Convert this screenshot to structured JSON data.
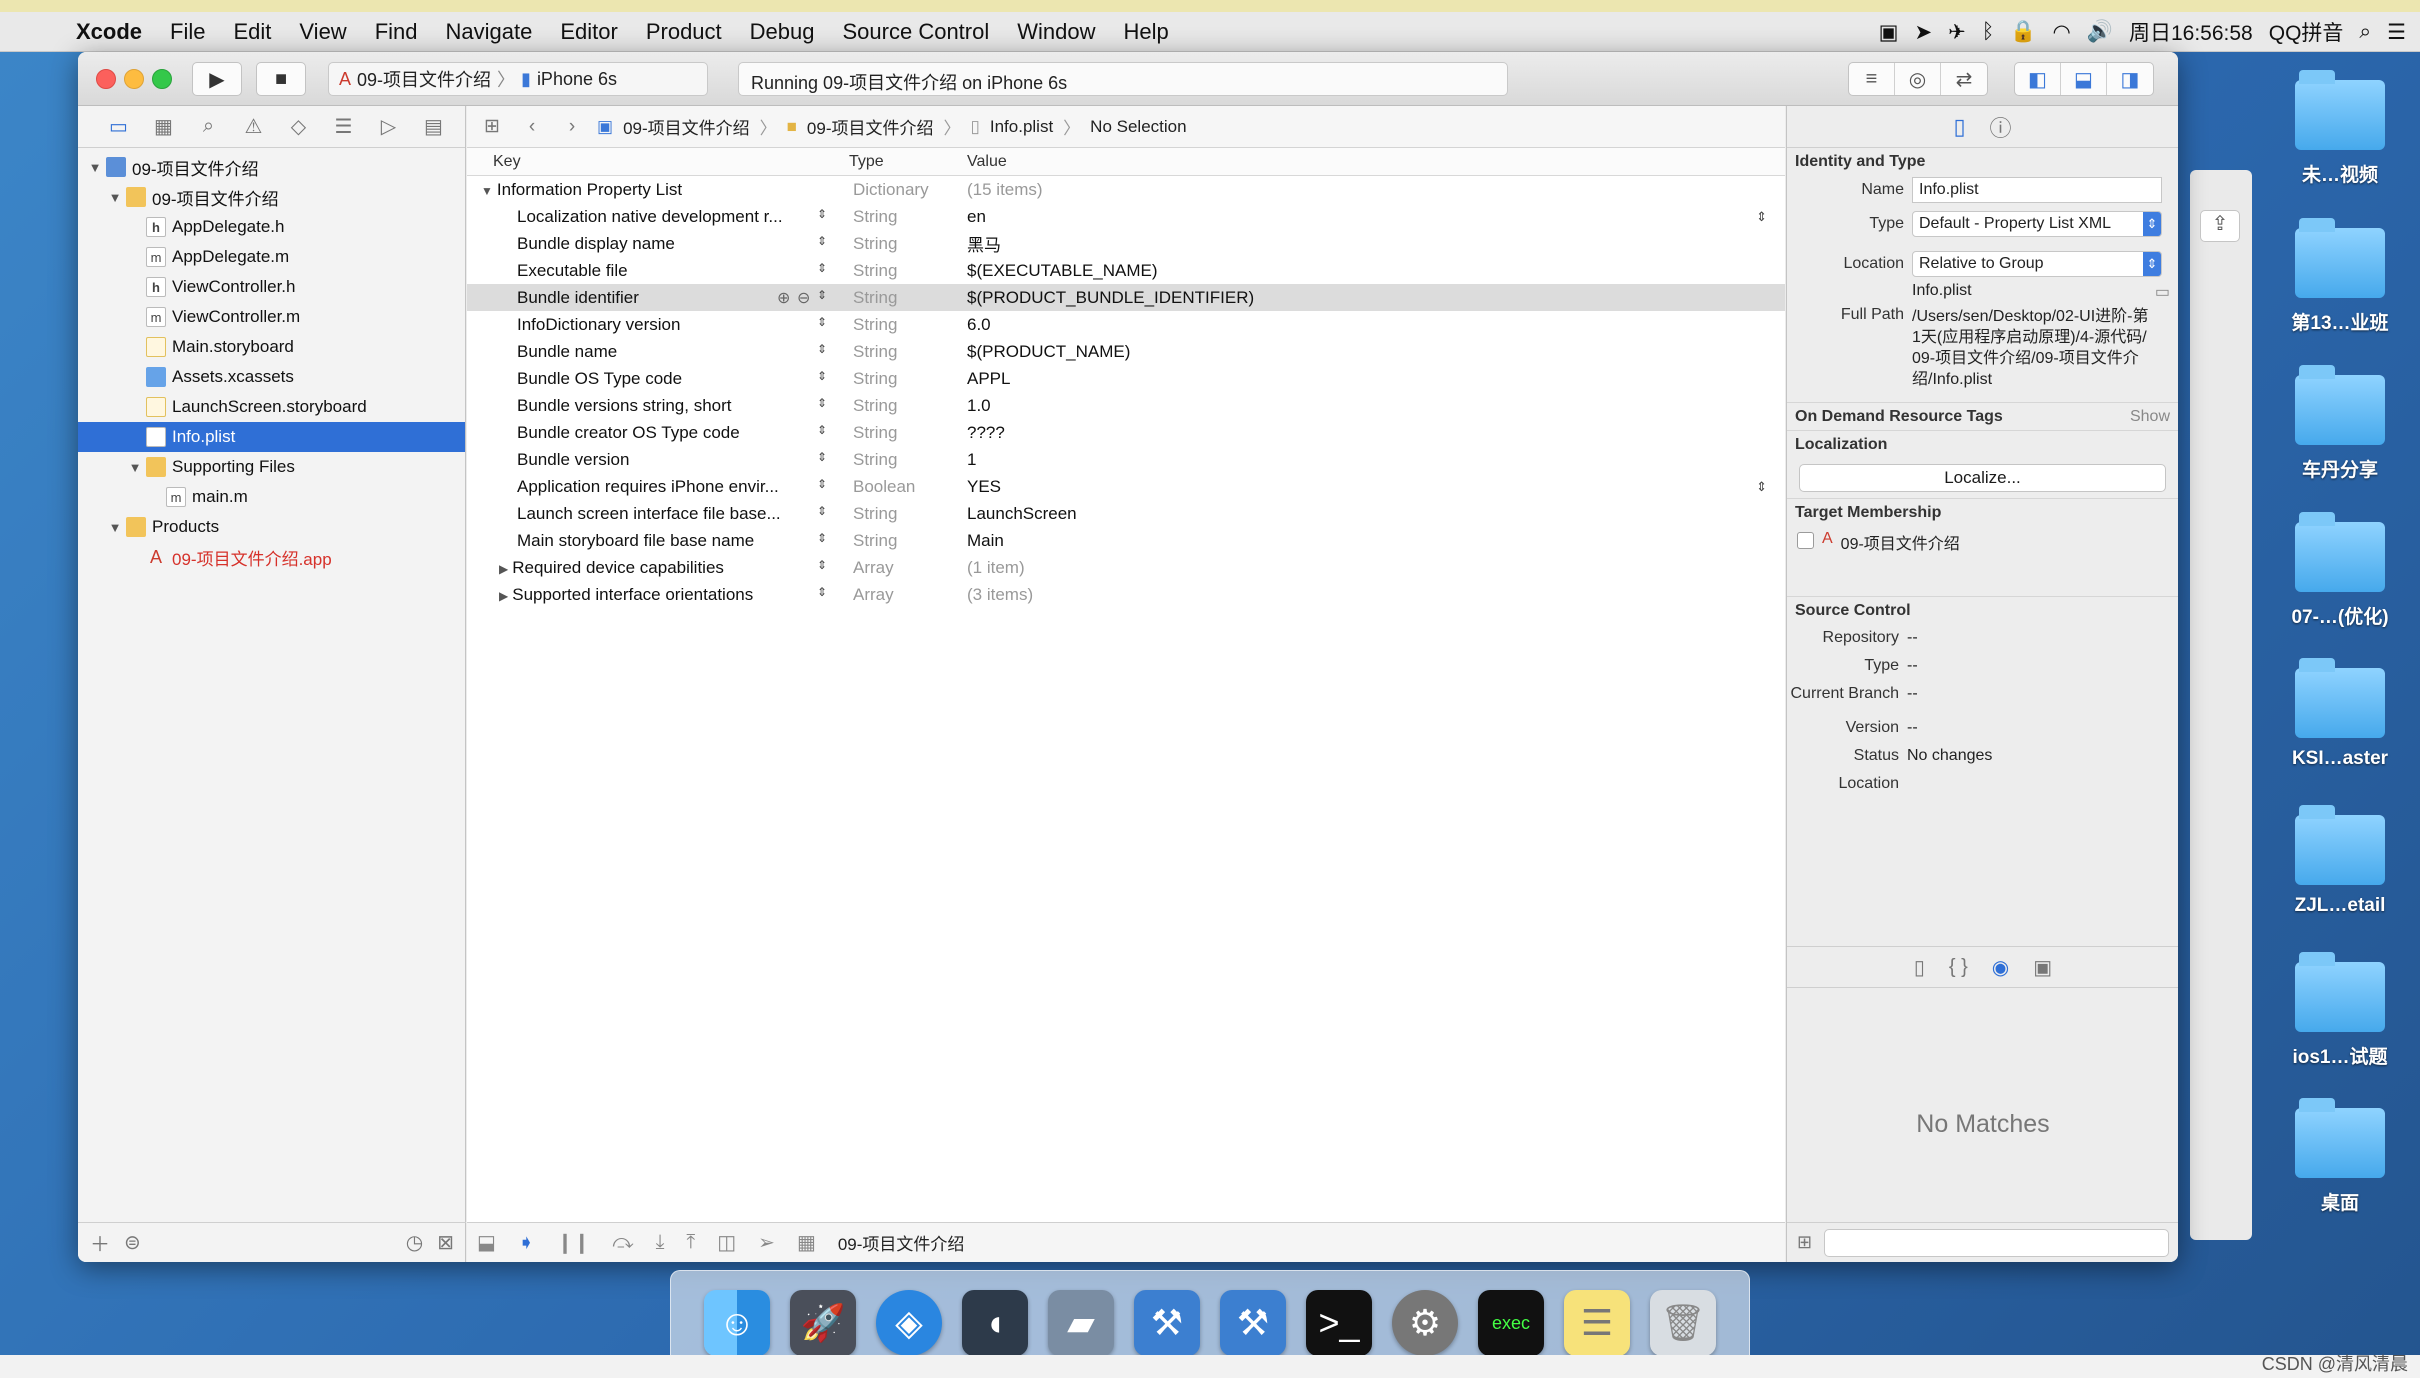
{
  "menubar": {
    "app": "Xcode",
    "items": [
      "File",
      "Edit",
      "View",
      "Find",
      "Navigate",
      "Editor",
      "Product",
      "Debug",
      "Source Control",
      "Window",
      "Help"
    ],
    "clock": "周日16:56:58",
    "ime": "QQ拼音"
  },
  "toolbar": {
    "scheme": "09-项目文件介绍",
    "device": "iPhone 6s",
    "activity": "Running 09-项目文件介绍 on iPhone 6s"
  },
  "navigator": {
    "items": [
      {
        "label": "09-项目文件介绍",
        "icon": "project-icon",
        "level": 0,
        "disclosure": "▼"
      },
      {
        "label": "09-项目文件介绍",
        "icon": "folder-icon",
        "level": 1,
        "disclosure": "▼"
      },
      {
        "label": "AppDelegate.h",
        "icon": "header-file-icon",
        "level": 2,
        "disclosure": ""
      },
      {
        "label": "AppDelegate.m",
        "icon": "implementation-file-icon",
        "level": 2,
        "disclosure": ""
      },
      {
        "label": "ViewController.h",
        "icon": "header-file-icon",
        "level": 2,
        "disclosure": ""
      },
      {
        "label": "ViewController.m",
        "icon": "implementation-file-icon",
        "level": 2,
        "disclosure": ""
      },
      {
        "label": "Main.storyboard",
        "icon": "storyboard-icon",
        "level": 2,
        "disclosure": ""
      },
      {
        "label": "Assets.xcassets",
        "icon": "asset-catalog-icon",
        "level": 2,
        "disclosure": ""
      },
      {
        "label": "LaunchScreen.storyboard",
        "icon": "storyboard-icon",
        "level": 2,
        "disclosure": ""
      },
      {
        "label": "Info.plist",
        "icon": "plist-file-icon",
        "level": 2,
        "disclosure": "",
        "selected": true
      },
      {
        "label": "Supporting Files",
        "icon": "folder-icon",
        "level": 2,
        "disclosure": "▼"
      },
      {
        "label": "main.m",
        "icon": "implementation-file-icon",
        "level": 3,
        "disclosure": ""
      },
      {
        "label": "Products",
        "icon": "folder-icon",
        "level": 1,
        "disclosure": "▼"
      },
      {
        "label": "09-项目文件介绍.app",
        "icon": "app-icon",
        "level": 2,
        "disclosure": "",
        "red": true
      }
    ]
  },
  "jumpbar": {
    "crumbs": [
      "09-项目文件介绍",
      "09-项目文件介绍",
      "Info.plist",
      "No Selection"
    ]
  },
  "plist": {
    "headers": {
      "key": "Key",
      "type": "Type",
      "value": "Value"
    },
    "rows": [
      {
        "key": "Information Property List",
        "type": "Dictionary",
        "value": "(15 items)",
        "root": true,
        "disclosure": "▼"
      },
      {
        "key": "Localization native development r...",
        "type": "String",
        "value": "en",
        "popup": true
      },
      {
        "key": "Bundle display name",
        "type": "String",
        "value": "黑马"
      },
      {
        "key": "Executable file",
        "type": "String",
        "value": "$(EXECUTABLE_NAME)"
      },
      {
        "key": "Bundle identifier",
        "type": "String",
        "value": "$(PRODUCT_BUNDLE_IDENTIFIER)",
        "selected": true
      },
      {
        "key": "InfoDictionary version",
        "type": "String",
        "value": "6.0"
      },
      {
        "key": "Bundle name",
        "type": "String",
        "value": "$(PRODUCT_NAME)"
      },
      {
        "key": "Bundle OS Type code",
        "type": "String",
        "value": "APPL"
      },
      {
        "key": "Bundle versions string, short",
        "type": "String",
        "value": "1.0"
      },
      {
        "key": "Bundle creator OS Type code",
        "type": "String",
        "value": "????"
      },
      {
        "key": "Bundle version",
        "type": "String",
        "value": "1"
      },
      {
        "key": "Application requires iPhone envir...",
        "type": "Boolean",
        "value": "YES",
        "popup": true
      },
      {
        "key": "Launch screen interface file base...",
        "type": "String",
        "value": "LaunchScreen"
      },
      {
        "key": "Main storyboard file base name",
        "type": "String",
        "value": "Main"
      },
      {
        "key": "Required device capabilities",
        "type": "Array",
        "value": "(1 item)",
        "disclosure": "▶"
      },
      {
        "key": "Supported interface orientations",
        "type": "Array",
        "value": "(3 items)",
        "disclosure": "▶"
      }
    ]
  },
  "editor_bottom": {
    "target": "09-项目文件介绍"
  },
  "inspector": {
    "identity_title": "Identity and Type",
    "name_label": "Name",
    "name_value": "Info.plist",
    "type_label": "Type",
    "type_value": "Default - Property List XML",
    "location_label": "Location",
    "location_value": "Relative to Group",
    "location_file": "Info.plist",
    "fullpath_label": "Full Path",
    "fullpath_value": "/Users/sen/Desktop/02-UI进阶-第1天(应用程序启动原理)/4-源代码/09-项目文件介绍/09-项目文件介绍/Info.plist",
    "odr_title": "On Demand Resource Tags",
    "odr_show": "Show",
    "localization_title": "Localization",
    "localize_button": "Localize...",
    "target_title": "Target Membership",
    "target_name": "09-项目文件介绍",
    "source_title": "Source Control",
    "sc_rows": [
      {
        "label": "Repository",
        "value": "--"
      },
      {
        "label": "Type",
        "value": "--"
      },
      {
        "label": "Current Branch",
        "value": "--"
      },
      {
        "label": "Version",
        "value": "--"
      },
      {
        "label": "Status",
        "value": "No changes"
      },
      {
        "label": "Location",
        "value": ""
      }
    ],
    "no_matches": "No Matches"
  },
  "desktop": {
    "folders": [
      "未…视频",
      "第13…业班",
      "车丹分享",
      "07-…(优化)",
      "KSI…aster",
      "ZJL…etail",
      "ios1…试题",
      "桌面"
    ]
  },
  "watermark": "CSDN @清风清晨"
}
